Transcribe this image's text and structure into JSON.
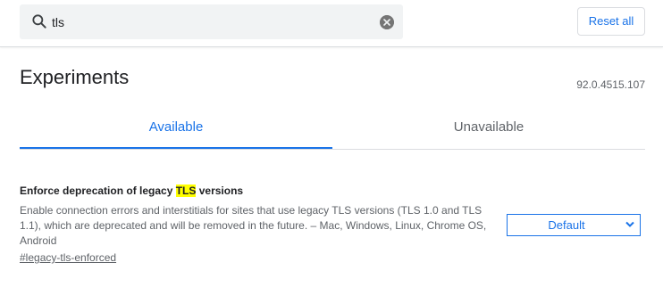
{
  "search": {
    "value": "tls",
    "icon": "search-icon",
    "clear_icon": "clear-icon"
  },
  "toolbar": {
    "reset_label": "Reset all"
  },
  "header": {
    "title": "Experiments",
    "version": "92.0.4515.107"
  },
  "tabs": [
    {
      "label": "Available",
      "active": true
    },
    {
      "label": "Unavailable",
      "active": false
    }
  ],
  "experiment": {
    "title_before": "Enforce deprecation of legacy ",
    "title_match": "TLS",
    "title_after": " versions",
    "description": "Enable connection errors and interstitials for sites that use legacy TLS versions (TLS 1.0 and TLS 1.1), which are deprecated and will be removed in the future. – Mac, Windows, Linux, Chrome OS, Android",
    "link": "#legacy-tls-enforced",
    "selected": "Default"
  },
  "colors": {
    "accent": "#1a73e8",
    "highlight": "#ffff00",
    "search_bg": "#f1f3f4"
  }
}
